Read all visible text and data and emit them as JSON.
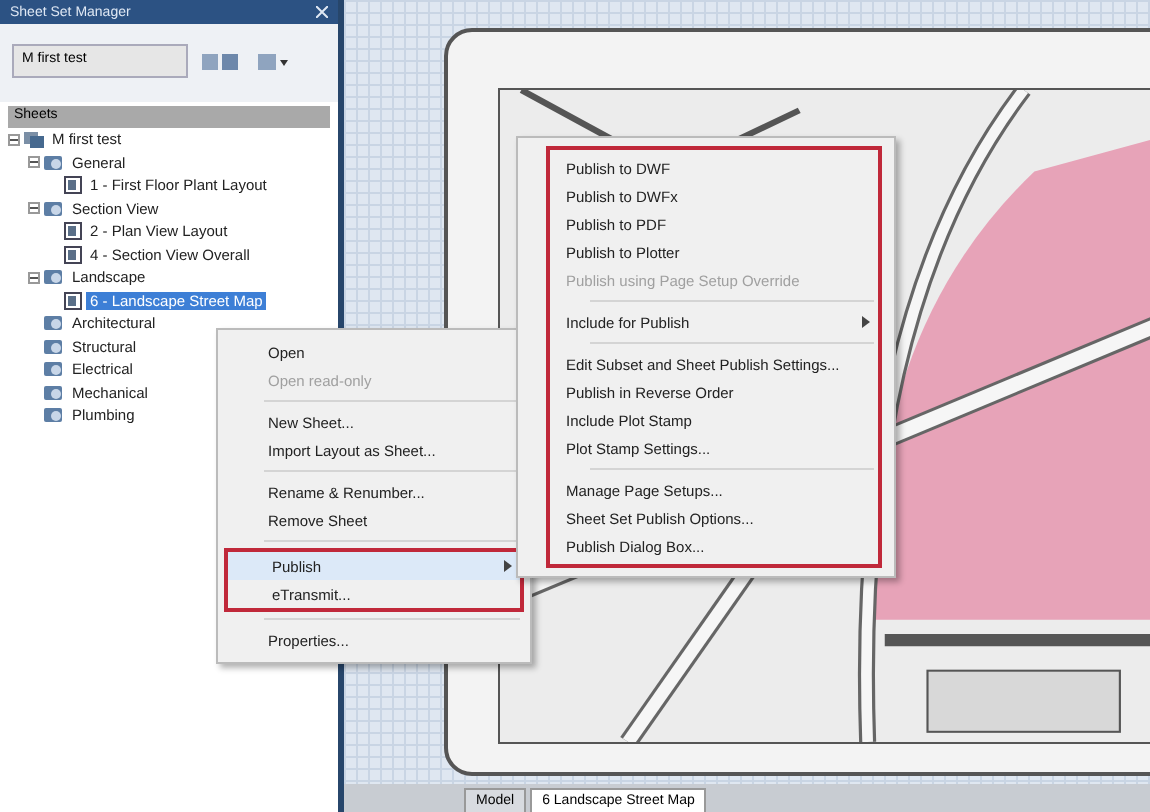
{
  "palette": {
    "title": "Sheet Set Manager",
    "sheet_set": "M first test",
    "header": "Sheets",
    "tree": [
      {
        "label": "M first test",
        "kind": "set",
        "selected": false,
        "expanded": true,
        "children": [
          {
            "label": "General",
            "kind": "subset",
            "selected": false,
            "expanded": true,
            "children": [
              {
                "label": "1 - First Floor Plant Layout",
                "kind": "sheet",
                "selected": false
              }
            ]
          },
          {
            "label": "Section View",
            "kind": "subset",
            "selected": false,
            "expanded": true,
            "children": [
              {
                "label": "2 - Plan View Layout",
                "kind": "sheet",
                "selected": false
              },
              {
                "label": "4 - Section View Overall",
                "kind": "sheet",
                "selected": false
              }
            ]
          },
          {
            "label": "Landscape",
            "kind": "subset",
            "selected": false,
            "expanded": true,
            "children": [
              {
                "label": "6 - Landscape Street Map",
                "kind": "sheet",
                "selected": true
              }
            ]
          },
          {
            "label": "Architectural",
            "kind": "subset",
            "selected": false
          },
          {
            "label": "Structural",
            "kind": "subset",
            "selected": false
          },
          {
            "label": "Electrical",
            "kind": "subset",
            "selected": false
          },
          {
            "label": "Mechanical",
            "kind": "subset",
            "selected": false
          },
          {
            "label": "Plumbing",
            "kind": "subset",
            "selected": false
          }
        ]
      }
    ]
  },
  "context_menu": {
    "groups": [
      [
        {
          "label": "Open",
          "disabled": false,
          "selected": false
        },
        {
          "label": "Open read-only",
          "disabled": true,
          "selected": false
        }
      ],
      [
        {
          "label": "New Sheet...",
          "disabled": false,
          "selected": false
        },
        {
          "label": "Import Layout as Sheet...",
          "disabled": false,
          "selected": false
        }
      ],
      [
        {
          "label": "Rename & Renumber...",
          "disabled": false,
          "selected": false
        },
        {
          "label": "Remove Sheet",
          "disabled": false,
          "selected": false
        }
      ],
      [
        {
          "label": "Publish",
          "disabled": false,
          "selected": true,
          "submenu": true
        },
        {
          "label": "eTransmit...",
          "disabled": false,
          "selected": false
        }
      ],
      [
        {
          "label": "Properties...",
          "disabled": false,
          "selected": false
        }
      ]
    ]
  },
  "publish_menu": {
    "groups": [
      [
        {
          "label": "Publish to DWF",
          "disabled": false
        },
        {
          "label": "Publish to DWFx",
          "disabled": false
        },
        {
          "label": "Publish to PDF",
          "disabled": false
        },
        {
          "label": "Publish to Plotter",
          "disabled": false
        },
        {
          "label": "Publish using Page Setup Override",
          "disabled": true
        }
      ],
      [
        {
          "label": "Include for Publish",
          "disabled": false,
          "submenu": true
        }
      ],
      [
        {
          "label": "Edit Subset and Sheet Publish Settings...",
          "disabled": false
        },
        {
          "label": "Publish in Reverse Order",
          "disabled": false
        },
        {
          "label": "Include Plot Stamp",
          "disabled": false
        },
        {
          "label": "Plot Stamp Settings...",
          "disabled": false
        }
      ],
      [
        {
          "label": "Manage Page Setups...",
          "disabled": false
        },
        {
          "label": "Sheet Set Publish Options...",
          "disabled": false
        },
        {
          "label": "Publish Dialog Box...",
          "disabled": false
        }
      ]
    ]
  },
  "layout_tabs": [
    {
      "label": "Model",
      "selected": false
    },
    {
      "label": "6 Landscape Street Map",
      "selected": true
    }
  ]
}
